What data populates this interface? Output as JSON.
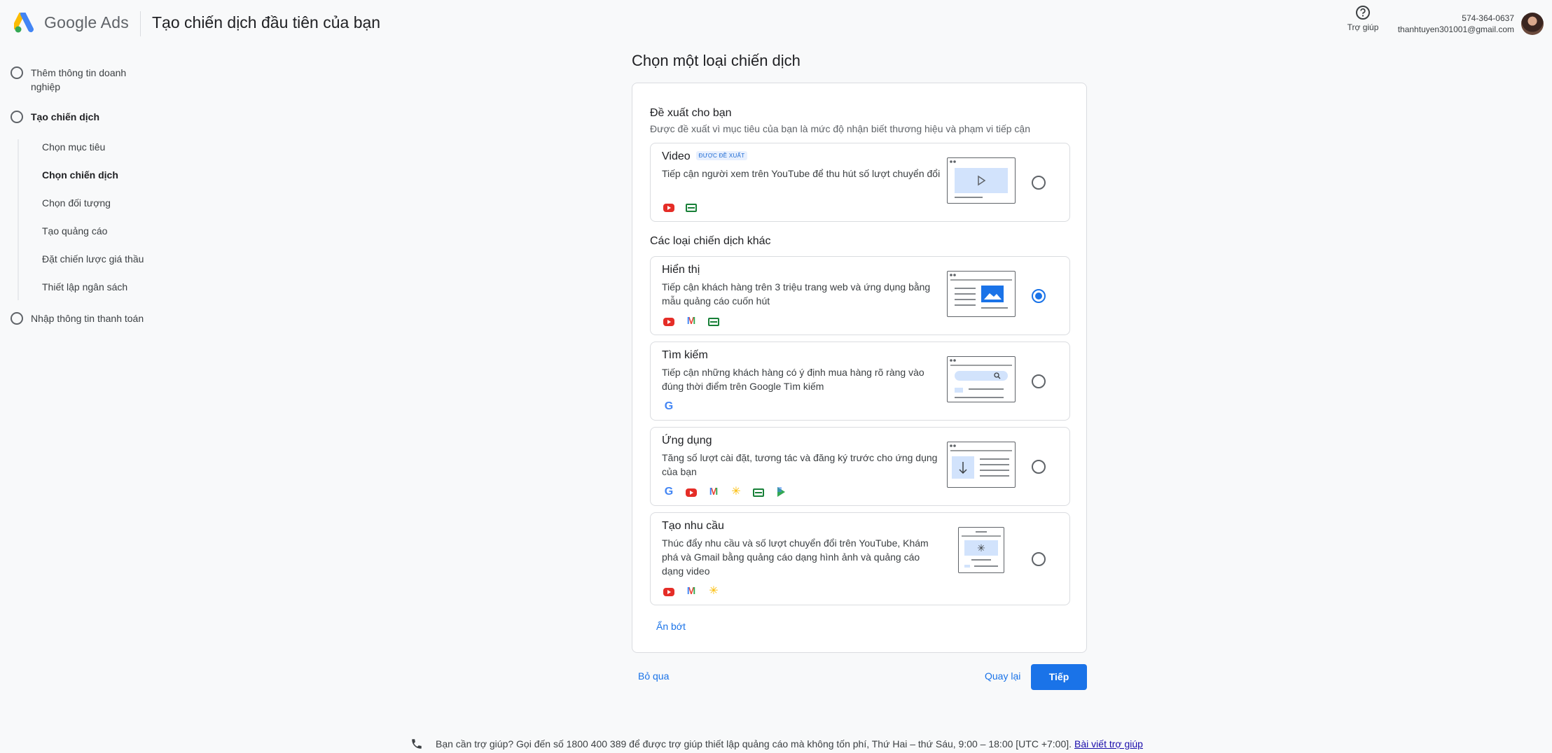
{
  "header": {
    "brand": "Google Ads",
    "title": "Tạo chiến dịch đầu tiên của bạn",
    "help_label": "Trợ giúp",
    "account_id": "574-364-0637",
    "account_email": "thanhtuyen301001@gmail.com"
  },
  "sidebar": {
    "steps": [
      {
        "label": "Thêm thông tin doanh nghiệp"
      },
      {
        "label": "Tạo chiến dịch"
      },
      {
        "label": "Nhập thông tin thanh toán"
      }
    ],
    "substeps": [
      {
        "label": "Chọn mục tiêu"
      },
      {
        "label": "Chọn chiến dịch"
      },
      {
        "label": "Chọn đối tượng"
      },
      {
        "label": "Tạo quảng cáo"
      },
      {
        "label": "Đặt chiến lược giá thầu"
      },
      {
        "label": "Thiết lập ngân sách"
      }
    ]
  },
  "main": {
    "title": "Chọn một loại chiến dịch",
    "recommended": {
      "title": "Đề xuất cho bạn",
      "subtitle": "Được đề xuất vì mục tiêu của bạn là mức độ nhận biết thương hiệu và phạm vi tiếp cận"
    },
    "other_title": "Các loại chiến dịch khác",
    "cards": [
      {
        "title": "Video",
        "badge": "ĐƯỢC ĐỀ XUẤT",
        "desc": "Tiếp cận người xem trên YouTube để thu hút số lượt chuyển đổi",
        "selected": false,
        "icons": [
          "youtube-icon",
          "sheet-icon"
        ]
      },
      {
        "title": "Hiển thị",
        "desc": "Tiếp cận khách hàng trên 3 triệu trang web và ứng dụng bằng mẫu quảng cáo cuốn hút",
        "selected": true,
        "icons": [
          "youtube-icon",
          "gmail-icon",
          "sheet-icon"
        ]
      },
      {
        "title": "Tìm kiếm",
        "desc": "Tiếp cận những khách hàng có ý định mua hàng rõ ràng vào đúng thời điểm trên Google Tìm kiếm",
        "selected": false,
        "icons": [
          "google-icon"
        ]
      },
      {
        "title": "Ứng dụng",
        "desc": "Tăng số lượt cài đặt, tương tác và đăng ký trước cho ứng dụng của bạn",
        "selected": false,
        "icons": [
          "google-icon",
          "youtube-icon",
          "gmail-icon",
          "discover-icon",
          "sheet-icon",
          "play-icon"
        ]
      },
      {
        "title": "Tạo nhu cầu",
        "desc": "Thúc đẩy nhu cầu và số lượt chuyển đổi trên YouTube, Khám phá và Gmail bằng quảng cáo dạng hình ảnh và quảng cáo dạng video",
        "selected": false,
        "icons": [
          "youtube-icon",
          "gmail-icon",
          "discover-icon"
        ]
      }
    ],
    "show_less": "Ẩn bớt"
  },
  "actions": {
    "skip": "Bỏ qua",
    "back": "Quay lại",
    "next": "Tiếp"
  },
  "support": {
    "text": "Bạn cần trợ giúp? Gọi đến số 1800 400 389 để được trợ giúp thiết lập quảng cáo mà không tốn phí, Thứ Hai – thứ Sáu, 9:00 – 18:00 [UTC +7:00].",
    "link": "Bài viết trợ giúp"
  },
  "colors": {
    "accent": "#1a73e8",
    "youtube": "#e52d27",
    "sheet": "#188038"
  }
}
